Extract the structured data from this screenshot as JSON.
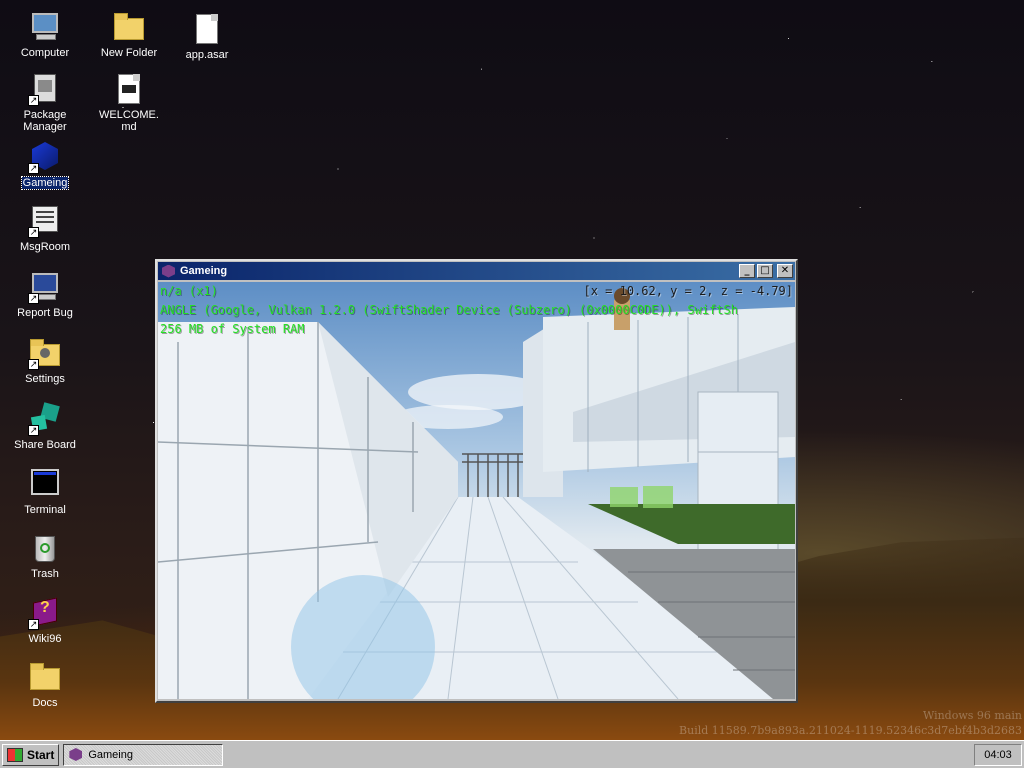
{
  "desktop": {
    "icons": [
      {
        "label": "Computer"
      },
      {
        "label": "New Folder"
      },
      {
        "label": "app.asar"
      },
      {
        "label": "Package Manager"
      },
      {
        "label": "WELCOME.md"
      },
      {
        "label": "Gameing"
      },
      {
        "label": "MsgRoom"
      },
      {
        "label": "Report Bug"
      },
      {
        "label": "Settings"
      },
      {
        "label": "Share Board"
      },
      {
        "label": "Terminal"
      },
      {
        "label": "Trash"
      },
      {
        "label": "Wiki96"
      },
      {
        "label": "Docs"
      }
    ],
    "watermark": {
      "line1": "Windows 96 main",
      "line2": "Build 11589.7b9a893a.211024-1119.52346c3d7ebf4b3d2683"
    }
  },
  "window": {
    "title": "Gameing",
    "minimize_glyph": "_",
    "maximize_glyph": "□",
    "close_glyph": "✕",
    "overlay": {
      "line1": "n/a (x1)",
      "line2": "ANGLE (Google, Vulkan 1.2.0 (SwiftShader Device (Subzero) (0x0000C0DE)), SwiftSh",
      "line3": "256 MB of System RAM",
      "coords": "[x = 10.62, y = 2, z = -4.79]"
    }
  },
  "taskbar": {
    "start_label": "Start",
    "task_label": "Gameing",
    "clock": "04:03"
  },
  "colors": {
    "titlebar_start": "#0a246a",
    "titlebar_end": "#3a6ea5",
    "overlay_green": "#25e025",
    "selection": "#0a246a"
  }
}
